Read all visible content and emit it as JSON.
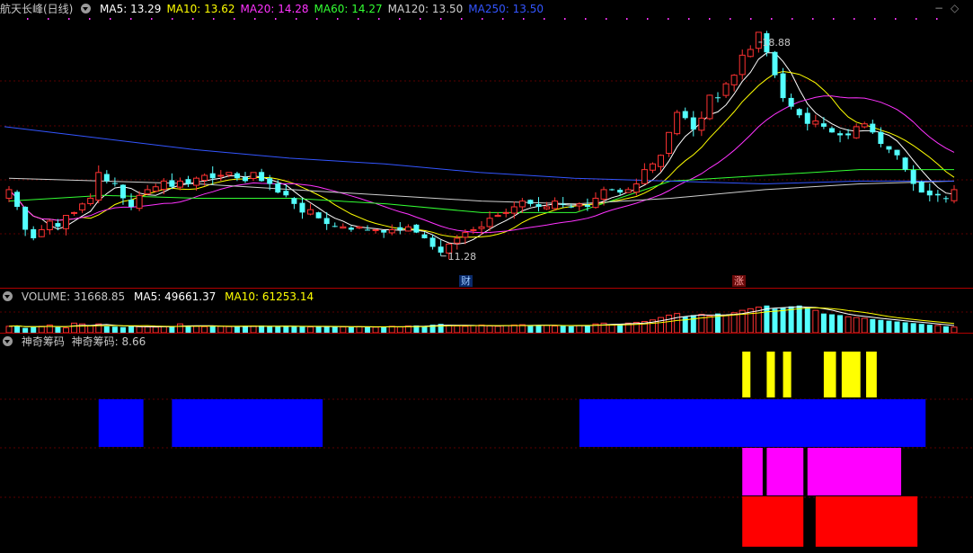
{
  "main_panel": {
    "stock_title": "航天长峰(日线)",
    "ma_legend": [
      {
        "label": "MA5: 13.29",
        "color": "#ffffff"
      },
      {
        "label": "MA10: 13.62",
        "color": "#ffff00"
      },
      {
        "label": "MA20: 14.28",
        "color": "#ff33ff"
      },
      {
        "label": "MA60: 14.27",
        "color": "#33ff33"
      },
      {
        "label": "MA120: 13.50",
        "color": "#cfcfcf"
      },
      {
        "label": "MA250: 13.50",
        "color": "#3355ff"
      }
    ],
    "high_label": "18.88",
    "low_label": "11.28",
    "event_marker_1": "财",
    "event_marker_2": "涨",
    "zoom_out_icon": "−",
    "settings_icon": "◇"
  },
  "volume_panel": {
    "label": "VOLUME: 31668.85",
    "ma5": "MA5: 49661.37",
    "ma10": "MA10: 61253.14",
    "colors": {
      "ma5": "#ffffff",
      "ma10": "#ffff00"
    }
  },
  "indicator_panel": {
    "name": "神奇筹码",
    "value_label": "神奇筹码: 8.66",
    "colors": {
      "yellow": "#ffff00",
      "blue": "#0000ff",
      "magenta": "#ff00ff",
      "red": "#ff0000"
    }
  },
  "chart_data": {
    "type": "candlestick",
    "y_range": [
      10.8,
      19.6
    ],
    "closes": [
      13.6,
      13.0,
      12.2,
      11.9,
      12.2,
      12.5,
      12.3,
      12.7,
      12.8,
      13.1,
      13.3,
      14.2,
      13.9,
      13.8,
      13.3,
      13.0,
      13.4,
      13.6,
      13.7,
      13.9,
      13.7,
      13.9,
      13.8,
      14.0,
      14.1,
      14.0,
      14.1,
      14.2,
      14.0,
      13.9,
      14.2,
      13.9,
      13.8,
      13.5,
      13.4,
      13.1,
      12.8,
      12.9,
      12.6,
      12.4,
      12.3,
      12.3,
      12.2,
      12.3,
      12.2,
      12.2,
      12.1,
      12.2,
      12.2,
      12.3,
      12.1,
      11.9,
      11.6,
      11.4,
      11.7,
      11.9,
      12.1,
      12.2,
      12.3,
      12.6,
      12.7,
      12.8,
      13.0,
      13.2,
      13.1,
      13.0,
      13.0,
      13.2,
      13.1,
      13.0,
      13.1,
      13.0,
      13.3,
      13.6,
      13.6,
      13.5,
      13.6,
      13.8,
      14.3,
      14.5,
      14.8,
      15.6,
      16.3,
      16.1,
      15.7,
      16.1,
      16.9,
      16.8,
      17.3,
      17.6,
      18.3,
      18.5,
      19.1,
      18.4,
      17.6,
      16.8,
      16.5,
      16.2,
      15.9,
      16.0,
      15.8,
      15.6,
      15.5,
      15.5,
      15.8,
      15.9,
      15.6,
      15.2,
      15.0,
      14.8,
      14.3,
      13.8,
      13.5,
      13.4,
      13.4,
      13.3,
      13.6
    ],
    "high_value": 18.88,
    "low_value": 11.28,
    "ma": [
      {
        "name": "MA5",
        "period": 5,
        "color": "#ffffff"
      },
      {
        "name": "MA10",
        "period": 10,
        "color": "#ffff00"
      },
      {
        "name": "MA20",
        "period": 20,
        "color": "#ff33ff"
      },
      {
        "name": "MA60",
        "color": "#33ff33",
        "values": [
          13.2,
          13.4,
          13.3,
          13.3,
          13.1,
          12.8,
          12.8,
          13.9,
          14.1,
          14.3,
          14.3
        ]
      },
      {
        "name": "MA120",
        "color": "#cfcfcf",
        "values": [
          14.0,
          13.9,
          13.8,
          13.6,
          13.4,
          13.2,
          13.1,
          13.3,
          13.6,
          13.8,
          13.9
        ]
      },
      {
        "name": "MA250",
        "color": "#3355ff",
        "values": [
          15.8,
          15.4,
          15.0,
          14.7,
          14.5,
          14.2,
          14.0,
          13.9,
          13.8,
          13.9,
          13.9
        ]
      }
    ],
    "volume_values": [
      40,
      45,
      30,
      35,
      40,
      48,
      35,
      30,
      60,
      55,
      45,
      55,
      40,
      38,
      35,
      40,
      38,
      36,
      35,
      38,
      40,
      55,
      45,
      40,
      38,
      42,
      40,
      38,
      36,
      40,
      42,
      45,
      40,
      38,
      42,
      38,
      40,
      36,
      38,
      40,
      38,
      36,
      35,
      38,
      36,
      35,
      38,
      40,
      36,
      42,
      45,
      40,
      50,
      55,
      45,
      42,
      40,
      45,
      48,
      42,
      40,
      45,
      48,
      50,
      45,
      48,
      45,
      42,
      45,
      40,
      45,
      48,
      55,
      60,
      50,
      55,
      60,
      65,
      70,
      80,
      95,
      110,
      120,
      100,
      110,
      115,
      105,
      120,
      110,
      125,
      140,
      150,
      160,
      170,
      150,
      155,
      165,
      170,
      160,
      140,
      120,
      115,
      110,
      100,
      95,
      90,
      85,
      80,
      75,
      70,
      65,
      60,
      55,
      50,
      45,
      40,
      35
    ],
    "indicator_blocks": [
      {
        "color": "yellow",
        "start": 90.0,
        "end": 91.0,
        "band": 0
      },
      {
        "color": "yellow",
        "start": 93.0,
        "end": 94.0,
        "band": 0
      },
      {
        "color": "yellow",
        "start": 95.0,
        "end": 96.0,
        "band": 0
      },
      {
        "color": "yellow",
        "start": 100.0,
        "end": 101.5,
        "band": 0
      },
      {
        "color": "yellow",
        "start": 102.2,
        "end": 104.5,
        "band": 0
      },
      {
        "color": "yellow",
        "start": 105.2,
        "end": 106.5,
        "band": 0
      },
      {
        "color": "blue",
        "start": 11.0,
        "end": 16.5,
        "band": 1
      },
      {
        "color": "blue",
        "start": 20.0,
        "end": 38.5,
        "band": 1
      },
      {
        "color": "blue",
        "start": 70.0,
        "end": 112.5,
        "band": 1
      },
      {
        "color": "magenta",
        "start": 90.0,
        "end": 92.5,
        "band": 2
      },
      {
        "color": "magenta",
        "start": 93.0,
        "end": 97.5,
        "band": 2
      },
      {
        "color": "magenta",
        "start": 98.0,
        "end": 109.5,
        "band": 2
      },
      {
        "color": "red",
        "start": 90.0,
        "end": 97.5,
        "band": 3
      },
      {
        "color": "red",
        "start": 99.0,
        "end": 111.5,
        "band": 3
      }
    ]
  }
}
